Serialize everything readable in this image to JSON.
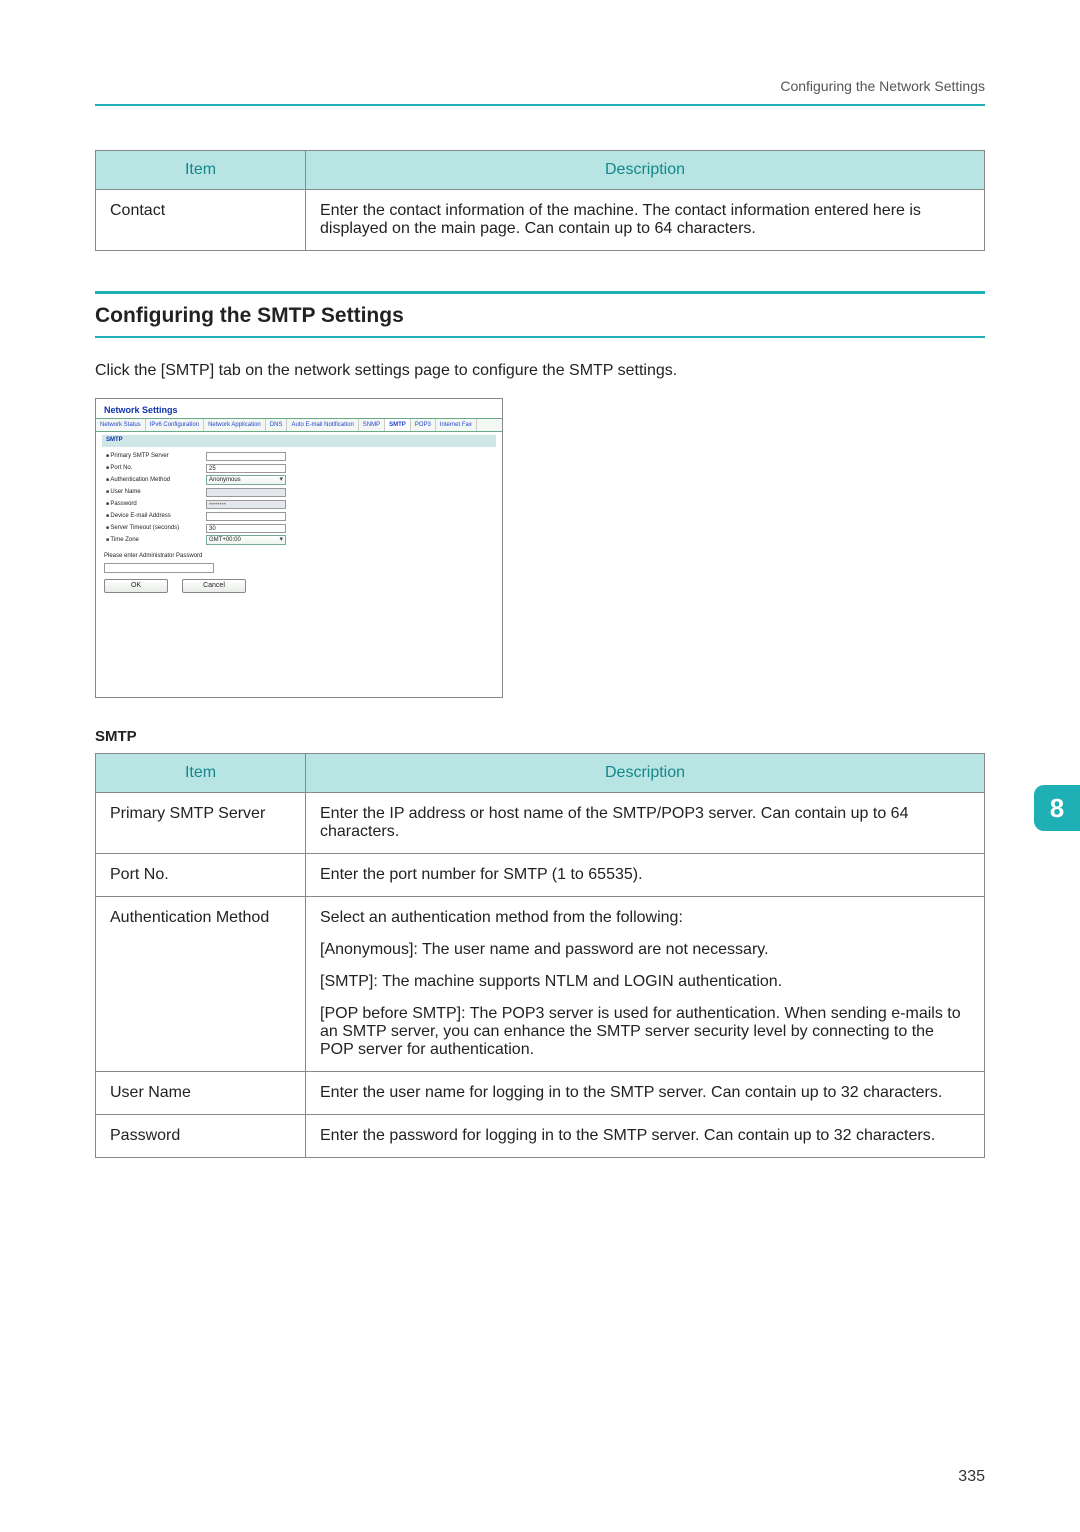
{
  "header": {
    "right_text": "Configuring the Network Settings"
  },
  "table1": {
    "headers": [
      "Item",
      "Description"
    ],
    "rows": [
      {
        "item": "Contact",
        "desc": "Enter the contact information of the machine. The contact information entered here is displayed on the main page. Can contain up to 64 characters."
      }
    ]
  },
  "section": {
    "title": "Configuring the SMTP Settings",
    "instruction": "Click the [SMTP] tab on the network settings page to configure the SMTP settings."
  },
  "screenshot": {
    "window_title": "Network Settings",
    "tabs": [
      "Network Status",
      "IPv6 Configuration",
      "Network Application",
      "DNS",
      "Auto E-mail Notification",
      "SNMP",
      "SMTP",
      "POP3",
      "Internet Fax"
    ],
    "bar": "SMTP",
    "fields": {
      "primary_smtp_server": {
        "label": "Primary SMTP Server",
        "value": ""
      },
      "port_no": {
        "label": "Port No.",
        "value": "25"
      },
      "auth_method": {
        "label": "Authentication Method",
        "value": "Anonymous"
      },
      "user_name": {
        "label": "User Name",
        "value": ""
      },
      "password": {
        "label": "Password",
        "value": "••••••••"
      },
      "device_email": {
        "label": "Device E-mail Address",
        "value": ""
      },
      "server_timeout": {
        "label": "Server Timeout (seconds)",
        "value": "30"
      },
      "time_zone": {
        "label": "Time Zone",
        "value": "GMT+00:00"
      }
    },
    "admin_note": "Please enter Administrator Password",
    "buttons": {
      "ok": "OK",
      "cancel": "Cancel"
    }
  },
  "smtp_heading": "SMTP",
  "table2": {
    "headers": [
      "Item",
      "Description"
    ],
    "rows": [
      {
        "item": "Primary SMTP Server",
        "desc": "Enter the IP address or host name of the SMTP/POP3 server. Can contain up to 64 characters."
      },
      {
        "item": "Port No.",
        "desc": "Enter the port number for SMTP (1 to 65535)."
      },
      {
        "item": "Authentication Method",
        "desc": "Select an authentication method from the following:\n[Anonymous]: The user name and password are not necessary.\n[SMTP]: The machine supports NTLM and LOGIN authentication.\n[POP before SMTP]: The POP3 server is used for authentication. When sending e-mails to an SMTP server, you can enhance the SMTP server security level by connecting to the POP server for authentication."
      },
      {
        "item": "User Name",
        "desc": "Enter the user name for logging in to the SMTP server. Can contain up to 32 characters."
      },
      {
        "item": "Password",
        "desc": "Enter the password for logging in to the SMTP server. Can contain up to 32 characters."
      }
    ]
  },
  "chapter_number": "8",
  "page_number": "335"
}
